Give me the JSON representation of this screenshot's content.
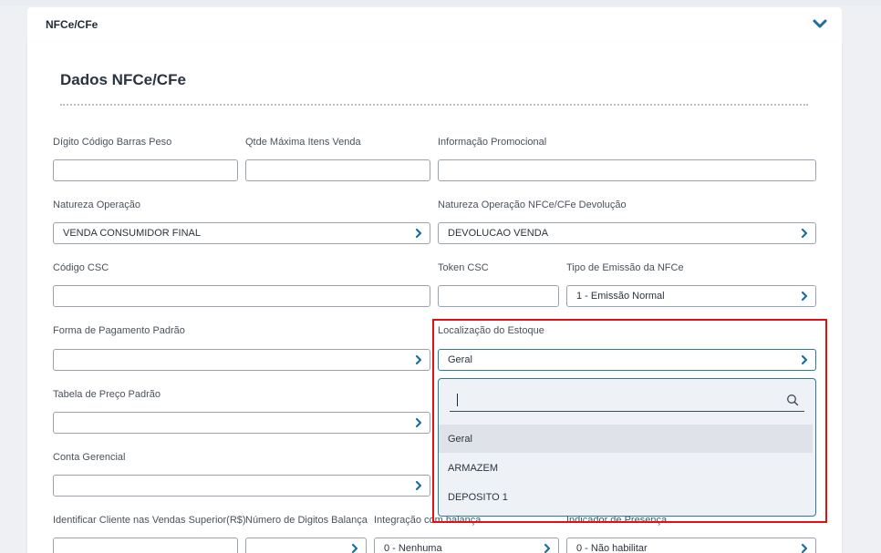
{
  "panel": {
    "title": "NFCe/CFe"
  },
  "section": {
    "title": "Dados NFCe/CFe"
  },
  "fields": {
    "digito_codigo_barras": {
      "label": "Dígito Código Barras Peso",
      "value": ""
    },
    "qtde_maxima_itens": {
      "label": "Qtde Máxima Itens Venda",
      "value": ""
    },
    "informacao_promocional": {
      "label": "Informação Promocional",
      "value": ""
    },
    "natureza_operacao": {
      "label": "Natureza Operação",
      "value": "VENDA CONSUMIDOR FINAL"
    },
    "natureza_operacao_devolucao": {
      "label": "Natureza Operação NFCe/CFe Devolução",
      "value": "DEVOLUCAO VENDA"
    },
    "codigo_csc": {
      "label": "Código CSC",
      "value": ""
    },
    "token_csc": {
      "label": "Token CSC",
      "value": ""
    },
    "tipo_emissao": {
      "label": "Tipo de Emissão da NFCe",
      "value": "1 - Emissão Normal"
    },
    "forma_pagamento": {
      "label": "Forma de Pagamento Padrão",
      "value": ""
    },
    "localizacao_estoque": {
      "label": "Localização do Estoque",
      "value": "Geral"
    },
    "tabela_preco": {
      "label": "Tabela de Preço Padrão",
      "value": ""
    },
    "conta_gerencial": {
      "label": "Conta Gerencial",
      "value": ""
    },
    "identificar_cliente": {
      "label": "Identificar Cliente nas Vendas Superior(R$)",
      "value": ""
    },
    "numero_digitos_balanca": {
      "label": "Número de Digitos Balança",
      "value": ""
    },
    "integracao_balanca": {
      "label": "Integração com balança",
      "value": "0 - Nenhuma"
    },
    "indicador_presenca": {
      "label": "Indicador de Presença",
      "value": "0 - Não habilitar"
    }
  },
  "dropdown": {
    "search_value": "",
    "options": [
      "Geral",
      "ARMAZEM",
      "DEPOSITO 1"
    ],
    "highlighted": "Geral"
  },
  "colors": {
    "accent": "#1a6f9e",
    "focus_border": "#2a7c94",
    "highlight_box": "#e01016"
  },
  "icons": {
    "collapse": "chevron-down-icon",
    "select": "chevron-right-icon",
    "search": "search-icon"
  }
}
